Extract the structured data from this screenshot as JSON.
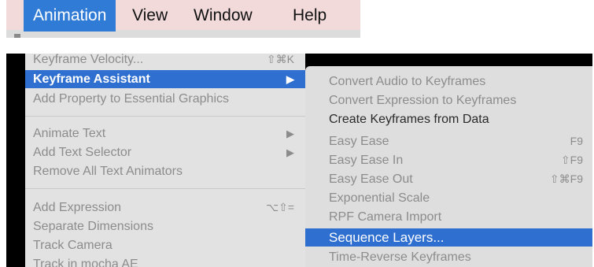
{
  "menubar": {
    "items": [
      {
        "label": "Animation",
        "active": true
      },
      {
        "label": "View",
        "active": false
      },
      {
        "label": "Window",
        "active": false
      },
      {
        "label": "Help",
        "active": false
      }
    ]
  },
  "animation_menu": {
    "items": [
      {
        "label": "Keyframe Velocity...",
        "shortcut": "⇧⌘K",
        "enabled": false
      },
      {
        "label": "Keyframe Assistant",
        "submenu": true,
        "highlighted": true
      },
      {
        "label": "Add Property to Essential Graphics",
        "enabled": false
      },
      {
        "label": "Animate Text",
        "submenu": true,
        "enabled": false
      },
      {
        "label": "Add Text Selector",
        "submenu": true,
        "enabled": false
      },
      {
        "label": "Remove All Text Animators",
        "enabled": false
      },
      {
        "label": "Add Expression",
        "shortcut": "⌥⇧=",
        "enabled": false
      },
      {
        "label": "Separate Dimensions",
        "enabled": false
      },
      {
        "label": "Track Camera",
        "enabled": false
      },
      {
        "label": "Track in mocha AE",
        "enabled": false
      }
    ]
  },
  "keyframe_assistant_submenu": {
    "items": [
      {
        "label": "Convert Audio to Keyframes",
        "enabled": false
      },
      {
        "label": "Convert Expression to Keyframes",
        "enabled": false
      },
      {
        "label": "Create Keyframes from Data",
        "enabled": true
      },
      {
        "label": "Easy Ease",
        "shortcut": "F9",
        "enabled": false
      },
      {
        "label": "Easy Ease In",
        "shortcut": "⇧F9",
        "enabled": false
      },
      {
        "label": "Easy Ease Out",
        "shortcut": "⇧⌘F9",
        "enabled": false
      },
      {
        "label": "Exponential Scale",
        "enabled": false
      },
      {
        "label": "RPF Camera Import",
        "enabled": false
      },
      {
        "label": "Sequence Layers...",
        "highlighted": true
      },
      {
        "label": "Time-Reverse Keyframes",
        "enabled": false
      }
    ]
  },
  "icons": {
    "submenu_arrow": "▶"
  },
  "colors": {
    "highlight": "#2f6fd0",
    "menubar_bg": "#f2dada",
    "menu_bg": "#e2e2e2"
  }
}
